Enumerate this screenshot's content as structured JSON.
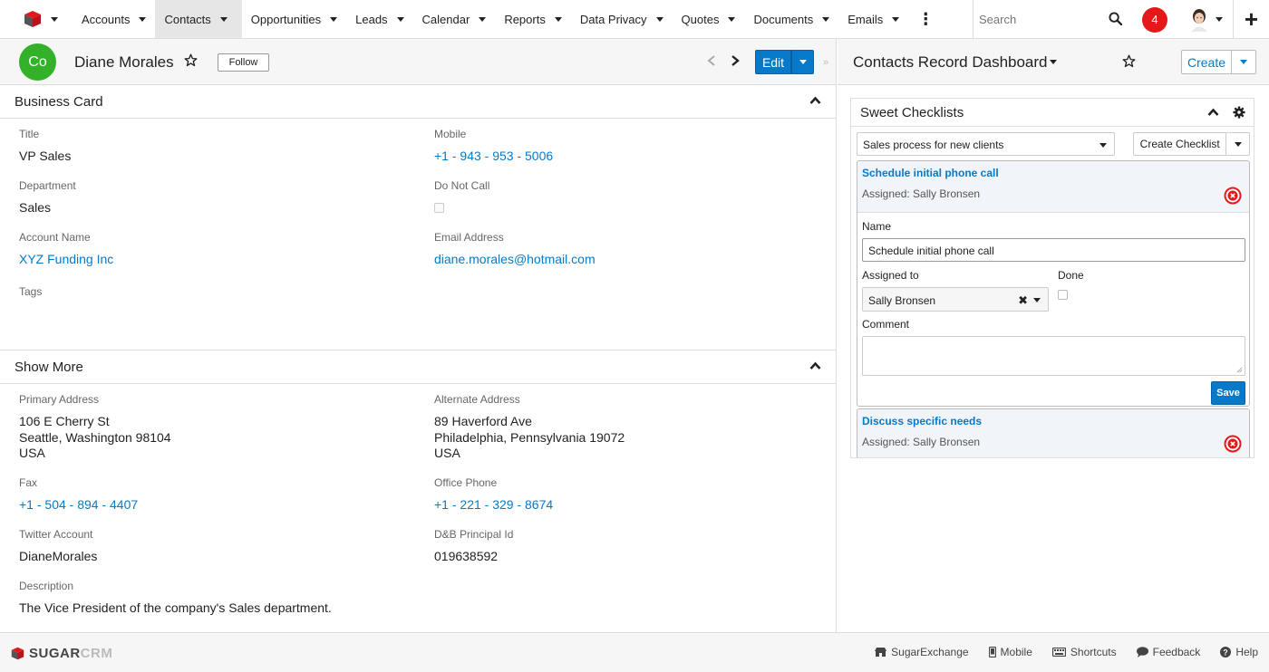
{
  "nav": {
    "items": [
      {
        "label": "Accounts",
        "active": false
      },
      {
        "label": "Contacts",
        "active": true
      },
      {
        "label": "Opportunities",
        "active": false
      },
      {
        "label": "Leads",
        "active": false
      },
      {
        "label": "Calendar",
        "active": false
      },
      {
        "label": "Reports",
        "active": false
      },
      {
        "label": "Data Privacy",
        "active": false
      },
      {
        "label": "Quotes",
        "active": false
      },
      {
        "label": "Documents",
        "active": false
      },
      {
        "label": "Emails",
        "active": false
      }
    ],
    "search_placeholder": "Search",
    "notification_count": "4"
  },
  "record": {
    "avatar_initials": "Co",
    "name": "Diane Morales",
    "follow_label": "Follow",
    "edit_label": "Edit"
  },
  "business_card": {
    "title": "Business Card",
    "fields": {
      "title": {
        "label": "Title",
        "value": "VP Sales"
      },
      "mobile": {
        "label": "Mobile",
        "value": "+1 - 943 - 953 - 5006"
      },
      "department": {
        "label": "Department",
        "value": "Sales"
      },
      "do_not_call": {
        "label": "Do Not Call",
        "checked": false
      },
      "account_name": {
        "label": "Account Name",
        "value": "XYZ Funding Inc"
      },
      "email": {
        "label": "Email Address",
        "value": "diane.morales@hotmail.com"
      },
      "tags": {
        "label": "Tags",
        "value": ""
      }
    }
  },
  "show_more": {
    "title": "Show More",
    "fields": {
      "primary_address": {
        "label": "Primary Address",
        "line1": "106 E Cherry St",
        "line2": "Seattle, Washington 98104",
        "line3": "USA"
      },
      "alternate_address": {
        "label": "Alternate Address",
        "line1": "89 Haverford Ave",
        "line2": "Philadelphia, Pennsylvania 19072",
        "line3": "USA"
      },
      "fax": {
        "label": "Fax",
        "value": "+1 - 504 - 894 - 4407"
      },
      "office_phone": {
        "label": "Office Phone",
        "value": "+1 - 221 - 329 - 8674"
      },
      "twitter": {
        "label": "Twitter Account",
        "value": "DianeMorales"
      },
      "dnb_id": {
        "label": "D&B Principal Id",
        "value": "019638592"
      },
      "description": {
        "label": "Description",
        "value": "The Vice President of the company's Sales department."
      }
    }
  },
  "dashboard": {
    "title": "Contacts Record Dashboard",
    "create_label": "Create",
    "dashlet": {
      "title": "Sweet Checklists",
      "selected_checklist": "Sales process for new clients",
      "create_checklist_label": "Create Checklist",
      "tasks": [
        {
          "name": "Schedule initial phone call",
          "assigned": "Assigned: Sally Bronsen",
          "form": {
            "name_label": "Name",
            "name_value": "Schedule initial phone call",
            "assigned_label": "Assigned to",
            "assigned_value": "Sally Bronsen",
            "done_label": "Done",
            "comment_label": "Comment",
            "save_label": "Save"
          }
        },
        {
          "name": "Discuss specific needs",
          "assigned": "Assigned: Sally Bronsen"
        }
      ]
    }
  },
  "footer": {
    "logo_main": "SUGAR",
    "logo_accent": "CRM",
    "links": [
      "SugarExchange",
      "Mobile",
      "Shortcuts",
      "Feedback",
      "Help"
    ]
  },
  "colors": {
    "accent": "#0679c8",
    "avatar": "#33b128",
    "notification": "#e61718",
    "delete": "#e61718"
  }
}
